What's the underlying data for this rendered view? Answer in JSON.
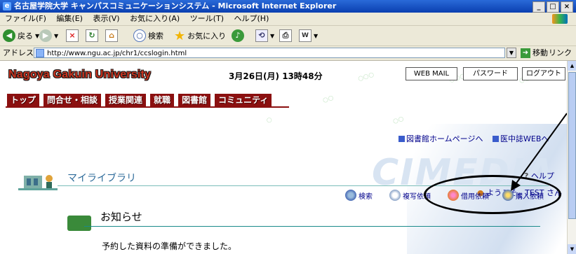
{
  "window": {
    "title": "名古屋学院大学  キャンパスコミュニケーションシステム - Microsoft Internet Explorer",
    "buttons": [
      "_",
      "□",
      "×"
    ]
  },
  "menubar": [
    "ファイル(F)",
    "編集(E)",
    "表示(V)",
    "お気に入り(A)",
    "ツール(T)",
    "ヘルプ(H)"
  ],
  "toolbar": {
    "back": "戻る",
    "search": "検索",
    "favorites": "お気に入り"
  },
  "address": {
    "label": "アドレス(D)",
    "url": "http://www.ngu.ac.jp/chr1/ccslogin.html",
    "go": "移動",
    "links": "リンク"
  },
  "header": {
    "logo": "Nagoya Gakuin University",
    "datetime": "3月26日(月) 13時48分",
    "buttons": {
      "webmail": "WEB MAIL",
      "password": "パスワード",
      "logout": "ログアウト"
    }
  },
  "nav": [
    "トップ",
    "問合せ・相談",
    "授業関連",
    "就職",
    "図書館",
    "コミュニティ"
  ],
  "library_links": {
    "home": "図書館ホームページへ",
    "medical": "医中誌WEBへ"
  },
  "help": "ヘルプ",
  "welcome": "ようこそ、TEST さん",
  "watermark": "CIMEDIA",
  "mylibrary": {
    "title": "マイライブラリ",
    "actions": [
      "検索",
      "複写依頼",
      "借用依頼",
      "購入依頼"
    ]
  },
  "notice": {
    "title": "お知らせ",
    "message": "予約した資料の準備ができました。"
  },
  "colors": {
    "nav_bg": "#8b1010",
    "logo_red": "#c8321e",
    "link_blue": "#00008b",
    "accent_teal": "#1a8a8a"
  }
}
